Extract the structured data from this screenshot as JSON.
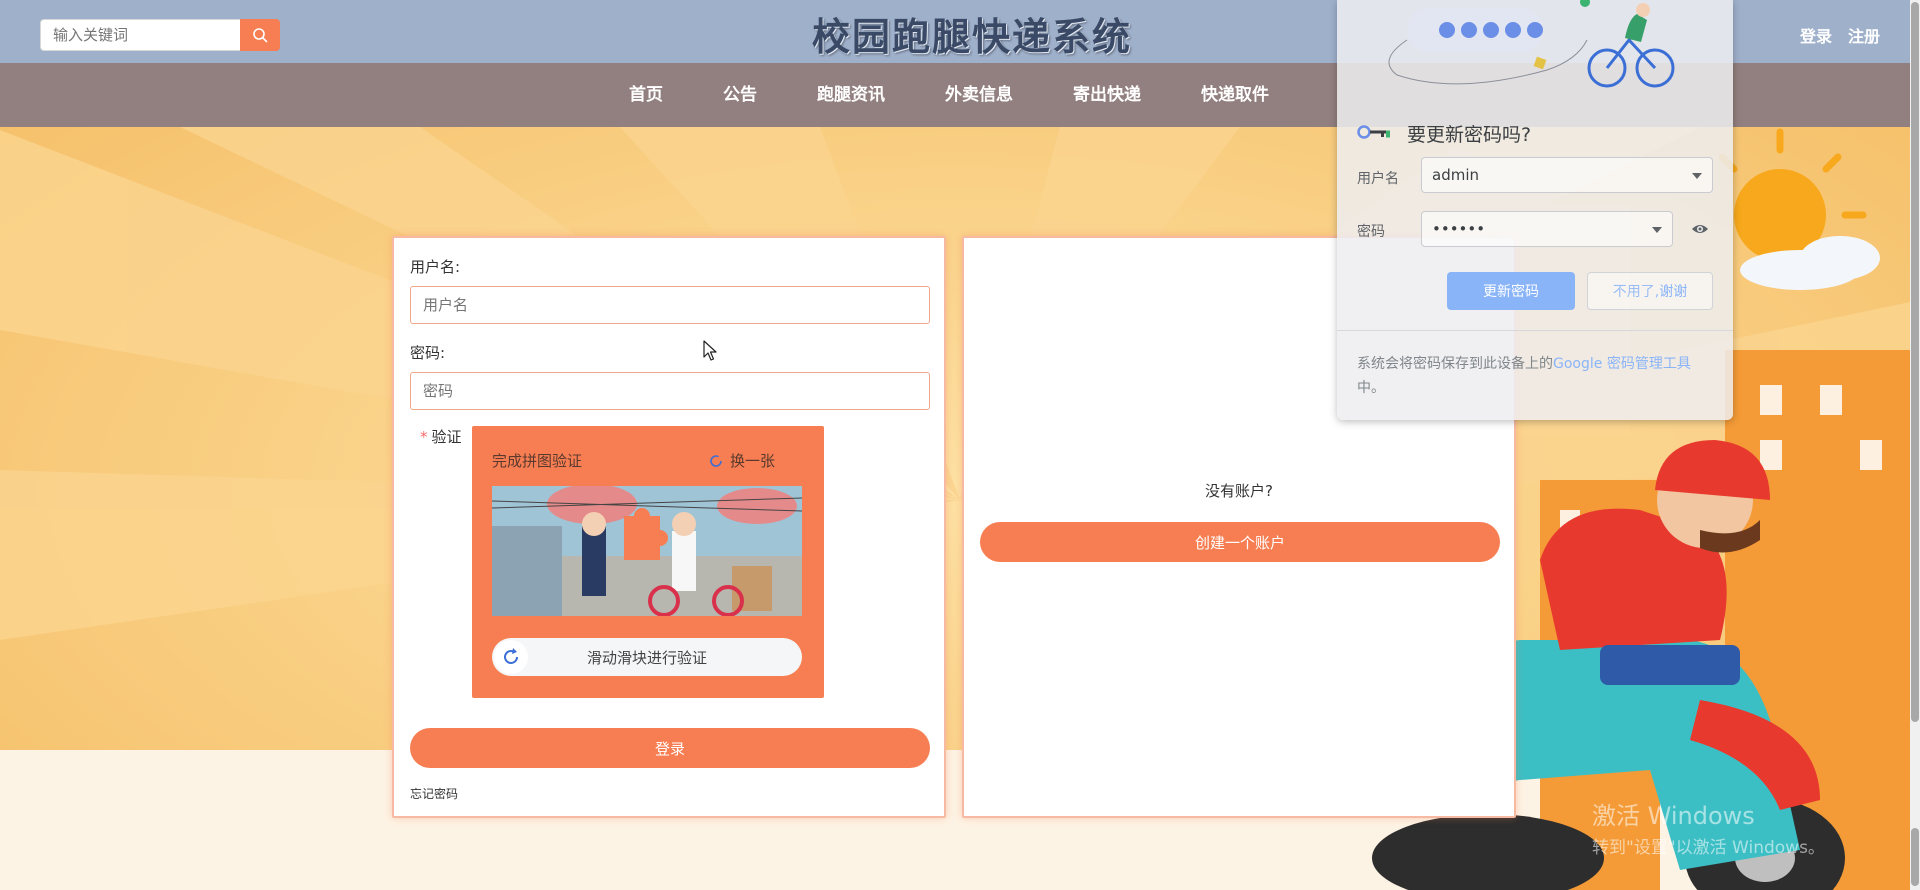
{
  "header": {
    "site_title": "校园跑腿快递系统",
    "search_placeholder": "输入关键词",
    "login_link": "登录",
    "register_link": "注册"
  },
  "nav": {
    "items": [
      "首页",
      "公告",
      "跑腿资讯",
      "外卖信息",
      "寄出快递",
      "快递取件"
    ]
  },
  "login_form": {
    "username_label": "用户名:",
    "username_placeholder": "用户名",
    "password_label": "密码:",
    "password_placeholder": "密码",
    "verify_required_mark": "*",
    "verify_label": "验证",
    "captcha_title": "完成拼图验证",
    "captcha_refresh": "换一张",
    "slider_text": "滑动滑块进行验证",
    "login_button": "登录",
    "forgot_password": "忘记密码"
  },
  "register_panel": {
    "no_account_text": "没有账户?",
    "create_button": "创建一个账户"
  },
  "password_popup": {
    "title": "要更新密码吗?",
    "username_label": "用户名",
    "username_value": "admin",
    "password_label": "密码",
    "password_value": "••••••",
    "update_button": "更新密码",
    "dismiss_button_part1": "不用了,",
    "dismiss_button_part2": "谢谢",
    "footer_part1": "系统会将密码保存到此设备上的",
    "footer_link": "Google 密码管理工具",
    "footer_part2": "中。"
  },
  "watermark": {
    "line1": "激活 Windows",
    "line2": "转到\"设置\"以激活 Windows。"
  },
  "colors": {
    "accent": "#f77e52",
    "header_bg": "#9fb0cb",
    "nav_bg": "#927f7f",
    "popup_button": "#8ab4f8"
  }
}
